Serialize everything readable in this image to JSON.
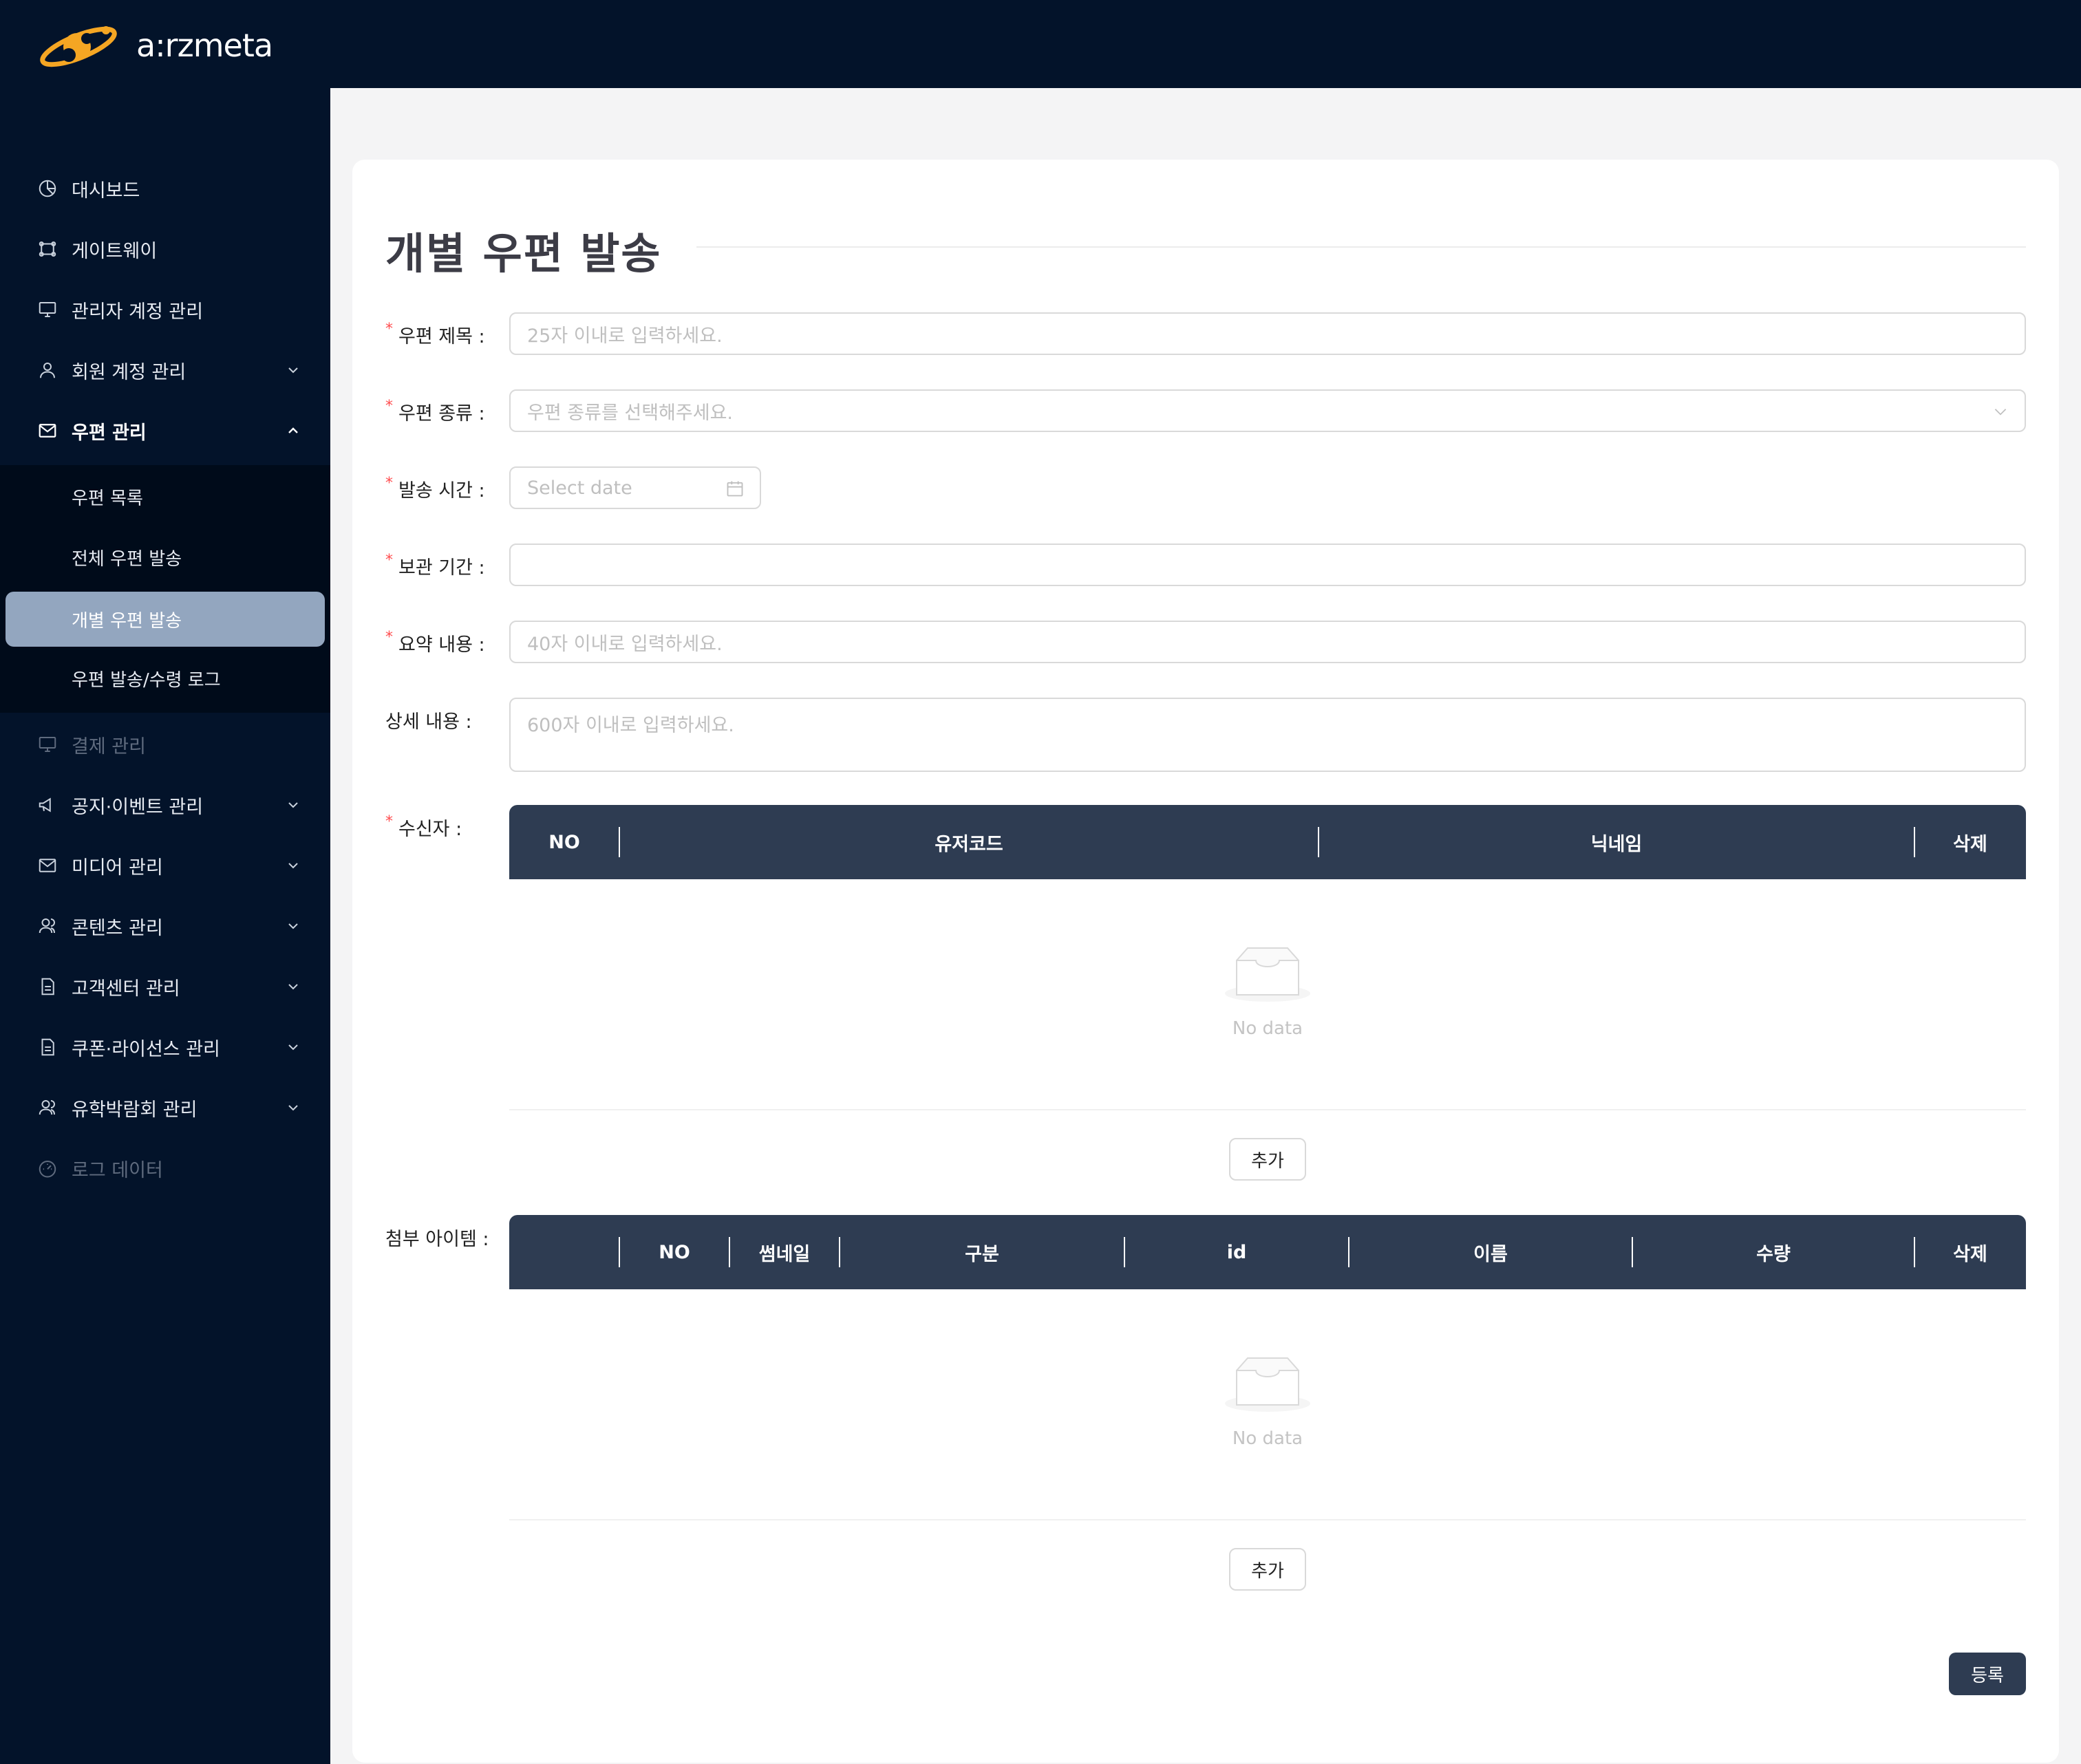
{
  "brand": {
    "name": "a:rzmeta"
  },
  "sidebar": {
    "items": [
      {
        "label": "대시보드",
        "icon": "pie-chart-icon"
      },
      {
        "label": "게이트웨이",
        "icon": "gateway-icon"
      },
      {
        "label": "관리자 계정 관리",
        "icon": "monitor-icon"
      },
      {
        "label": "회원 계정 관리",
        "icon": "user-icon"
      },
      {
        "label": "우편 관리",
        "icon": "mail-icon"
      },
      {
        "label": "결제 관리",
        "icon": "monitor-icon"
      },
      {
        "label": "공지·이벤트 관리",
        "icon": "megaphone-icon"
      },
      {
        "label": "미디어 관리",
        "icon": "mail-icon"
      },
      {
        "label": "콘텐츠 관리",
        "icon": "users-icon"
      },
      {
        "label": "고객센터 관리",
        "icon": "document-icon"
      },
      {
        "label": "쿠폰·라이선스 관리",
        "icon": "document-icon"
      },
      {
        "label": "유학박람회 관리",
        "icon": "users-icon"
      },
      {
        "label": "로그 데이터",
        "icon": "dashboard-icon"
      }
    ],
    "submenu": [
      {
        "label": "우편 목록"
      },
      {
        "label": "전체 우편 발송"
      },
      {
        "label": "개별 우편 발송"
      },
      {
        "label": "우편 발송/수령 로그"
      }
    ]
  },
  "page": {
    "title": "개별 우편 발송",
    "form": {
      "mail_title": {
        "label": "우편 제목 :",
        "placeholder": "25자 이내로 입력하세요."
      },
      "mail_type": {
        "label": "우편 종류 :",
        "placeholder": "우편 종류를 선택해주세요."
      },
      "send_time": {
        "label": "발송 시간 :",
        "placeholder": "Select date"
      },
      "retention": {
        "label": "보관 기간 :",
        "value": ""
      },
      "summary": {
        "label": "요약 내용 :",
        "placeholder": "40자 이내로 입력하세요."
      },
      "detail": {
        "label": "상세 내용 :",
        "placeholder": "600자 이내로 입력하세요."
      },
      "recipients": {
        "label": "수신자 :"
      },
      "attachments": {
        "label": "첨부 아이템 :"
      },
      "required_mark": "*"
    },
    "recipients_table": {
      "columns": [
        "NO",
        "유저코드",
        "닉네임",
        "삭제"
      ],
      "empty_text": "No data",
      "add_label": "추가"
    },
    "attachments_table": {
      "columns": [
        "",
        "NO",
        "썸네일",
        "구분",
        "id",
        "이름",
        "수량",
        "삭제"
      ],
      "empty_text": "No data",
      "add_label": "추가"
    },
    "submit_label": "등록"
  },
  "colors": {
    "sidebar_bg": "#03132a",
    "submenu_bg": "#000b1a",
    "active_item_bg": "#93a6bf",
    "table_header_bg": "#2e3c52",
    "required": "#ff4d4f",
    "brand_orange": "#f5a623"
  }
}
